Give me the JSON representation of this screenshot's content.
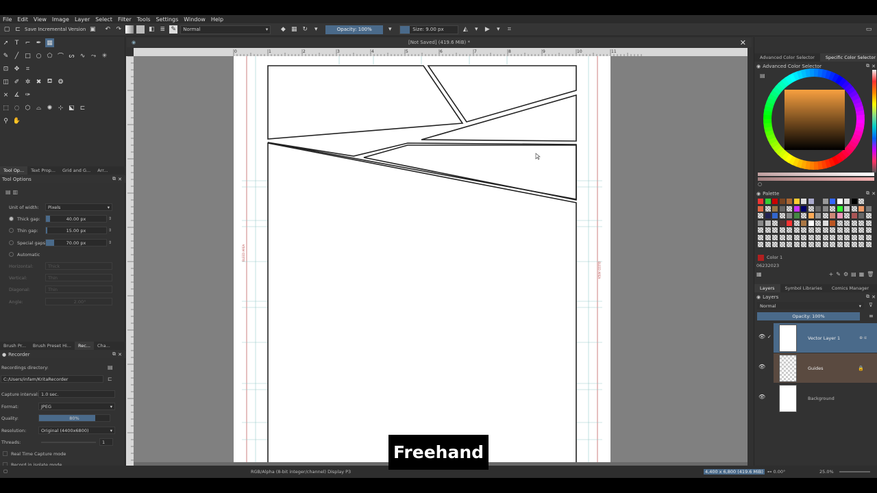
{
  "menu": [
    "File",
    "Edit",
    "View",
    "Image",
    "Layer",
    "Select",
    "Filter",
    "Tools",
    "Settings",
    "Window",
    "Help"
  ],
  "toolbar": {
    "save_incremental": "Save Incremental Version",
    "blend_mode": "Normal",
    "opacity": "Opacity: 100%",
    "size": "Size: 9.00 px"
  },
  "document": {
    "title": "[Not Saved]  (419.6 MiB) *"
  },
  "left_tabs": [
    "Tool Op...",
    "Text Prop...",
    "Grid and G...",
    "Arr..."
  ],
  "tool_options": {
    "title": "Tool Options",
    "unit_label": "Unit of width:",
    "unit_value": "Pixels",
    "thick_gap_label": "Thick gap:",
    "thick_gap_value": "40.00 px",
    "thin_gap_label": "Thin gap:",
    "thin_gap_value": "15.00 px",
    "special_gaps_label": "Special gaps:",
    "special_gaps_value": "70.00 px",
    "automatic_label": "Automatic",
    "horizontal_label": "Horizontal:",
    "horizontal_value": "Thick",
    "vertical_label": "Vertical:",
    "vertical_value": "Thin",
    "diagonal_label": "Diagonal:",
    "diagonal_value": "Thin",
    "angle_label": "Angle:",
    "angle_value": "2.00°"
  },
  "bottom_tabs": [
    "Brush Pr...",
    "Brush Preset Hi...",
    "Rec...",
    "Cha..."
  ],
  "recorder": {
    "title": "Recorder",
    "dir_label": "Recordings directory:",
    "dir_value": "C:/Users/infam/KritaRecorder",
    "interval_label": "Capture interval:",
    "interval_value": "1.0 sec.",
    "format_label": "Format:",
    "format_value": "JPEG",
    "quality_label": "Quality:",
    "quality_value": "80%",
    "quality_fraction": 0.8,
    "resolution_label": "Resolution:",
    "resolution_value": "Original (4400x6800)",
    "threads_label": "Threads:",
    "threads_value": "1",
    "realtime_label": "Real Time Capture mode",
    "isolate_label": "Record in isolate mode",
    "auto_label": "Record automatically"
  },
  "color_tabs": [
    "Advanced Color Selector",
    "Specific Color Selector"
  ],
  "color_selector_title": "Advanced Color Selector",
  "palette": {
    "title": "Palette",
    "current_color_name": "Color 1",
    "palette_name": "06232023"
  },
  "layer_tabs": [
    "Layers",
    "Symbol Libraries",
    "Comics Manager"
  ],
  "layers_panel": {
    "title": "Layers",
    "blend_mode": "Normal",
    "opacity": "Opacity: 100%",
    "layers": [
      {
        "name": "Vector Layer 1"
      },
      {
        "name": "Guides"
      },
      {
        "name": "Background"
      }
    ]
  },
  "statusbar": {
    "color_space": "RGB/Alpha (8-bit integer/channel)  Display P3",
    "image_size": "4,400 x 6,800 (419.6 MiB)",
    "rotation": "0.00°",
    "zoom": "25.0%"
  },
  "caption": "Freehand",
  "colors": {
    "accent": "#4a6a8a",
    "panel": "#323232",
    "canvas_bg": "#808080",
    "guides_layer": "#5a4a40"
  }
}
